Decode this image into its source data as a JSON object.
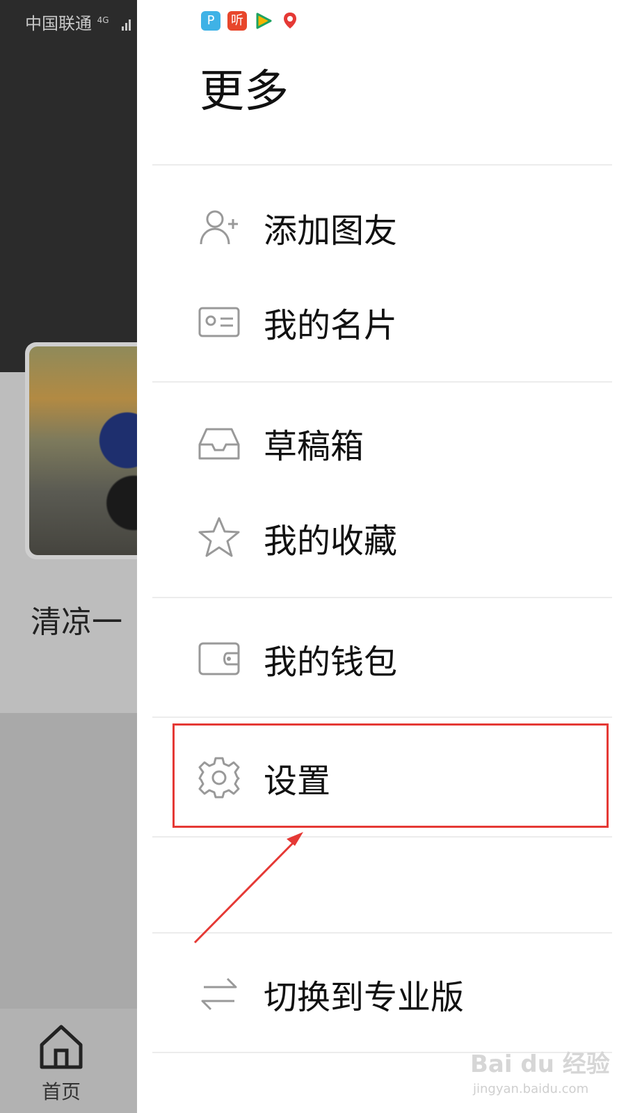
{
  "status_bar": {
    "carrier": "中国联通",
    "network": "4G"
  },
  "background_app": {
    "card_title": "清凉一",
    "bottom_nav": {
      "home_label": "首页"
    }
  },
  "drawer": {
    "app_icons": [
      {
        "name": "p-app-icon",
        "glyph": "P"
      },
      {
        "name": "listen-app-icon",
        "glyph": "听"
      },
      {
        "name": "video-play-icon",
        "glyph": "▶"
      },
      {
        "name": "map-pin-icon",
        "glyph": "📍"
      }
    ],
    "title": "更多",
    "items": [
      {
        "id": "add-friend",
        "label": "添加图友",
        "icon": "add-user-icon"
      },
      {
        "id": "my-card",
        "label": "我的名片",
        "icon": "id-card-icon"
      },
      {
        "id": "drafts",
        "label": "草稿箱",
        "icon": "inbox-icon"
      },
      {
        "id": "favorites",
        "label": "我的收藏",
        "icon": "star-icon"
      },
      {
        "id": "wallet",
        "label": "我的钱包",
        "icon": "wallet-icon"
      },
      {
        "id": "settings",
        "label": "设置",
        "icon": "gear-icon"
      },
      {
        "id": "switch-pro",
        "label": "切换到专业版",
        "icon": "swap-icon"
      }
    ]
  },
  "watermark": {
    "logo": "Bai du 经验",
    "url": "jingyan.baidu.com"
  },
  "colors": {
    "highlight": "#e53935",
    "divider": "#ececec",
    "dim_dark": "#2b2b2b"
  }
}
